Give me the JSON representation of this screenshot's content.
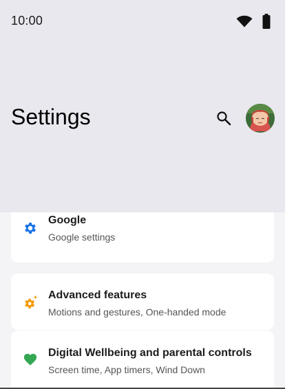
{
  "status_bar": {
    "time": "10:00",
    "icons": [
      "wifi-icon",
      "battery-icon"
    ]
  },
  "header": {
    "title": "Settings",
    "search_icon": "search-icon",
    "avatar": "avatar"
  },
  "items": [
    {
      "title": "Google",
      "subtitle": "Google settings",
      "icon": "gear-icon",
      "icon_color": "#1a73e8"
    },
    {
      "title": "Advanced features",
      "subtitle": "Motions and gestures, One-handed mode",
      "icon": "sparkle-gear-icon",
      "icon_color": "#f29900"
    },
    {
      "title": "Digital Wellbeing and parental controls",
      "subtitle": "Screen time, App timers, Wind Down",
      "icon": "heart-icon",
      "icon_color": "#34a853"
    }
  ],
  "colors": {
    "header_bg": "#e8e8ee",
    "content_bg": "#f4f4f6",
    "card_bg": "#ffffff"
  }
}
